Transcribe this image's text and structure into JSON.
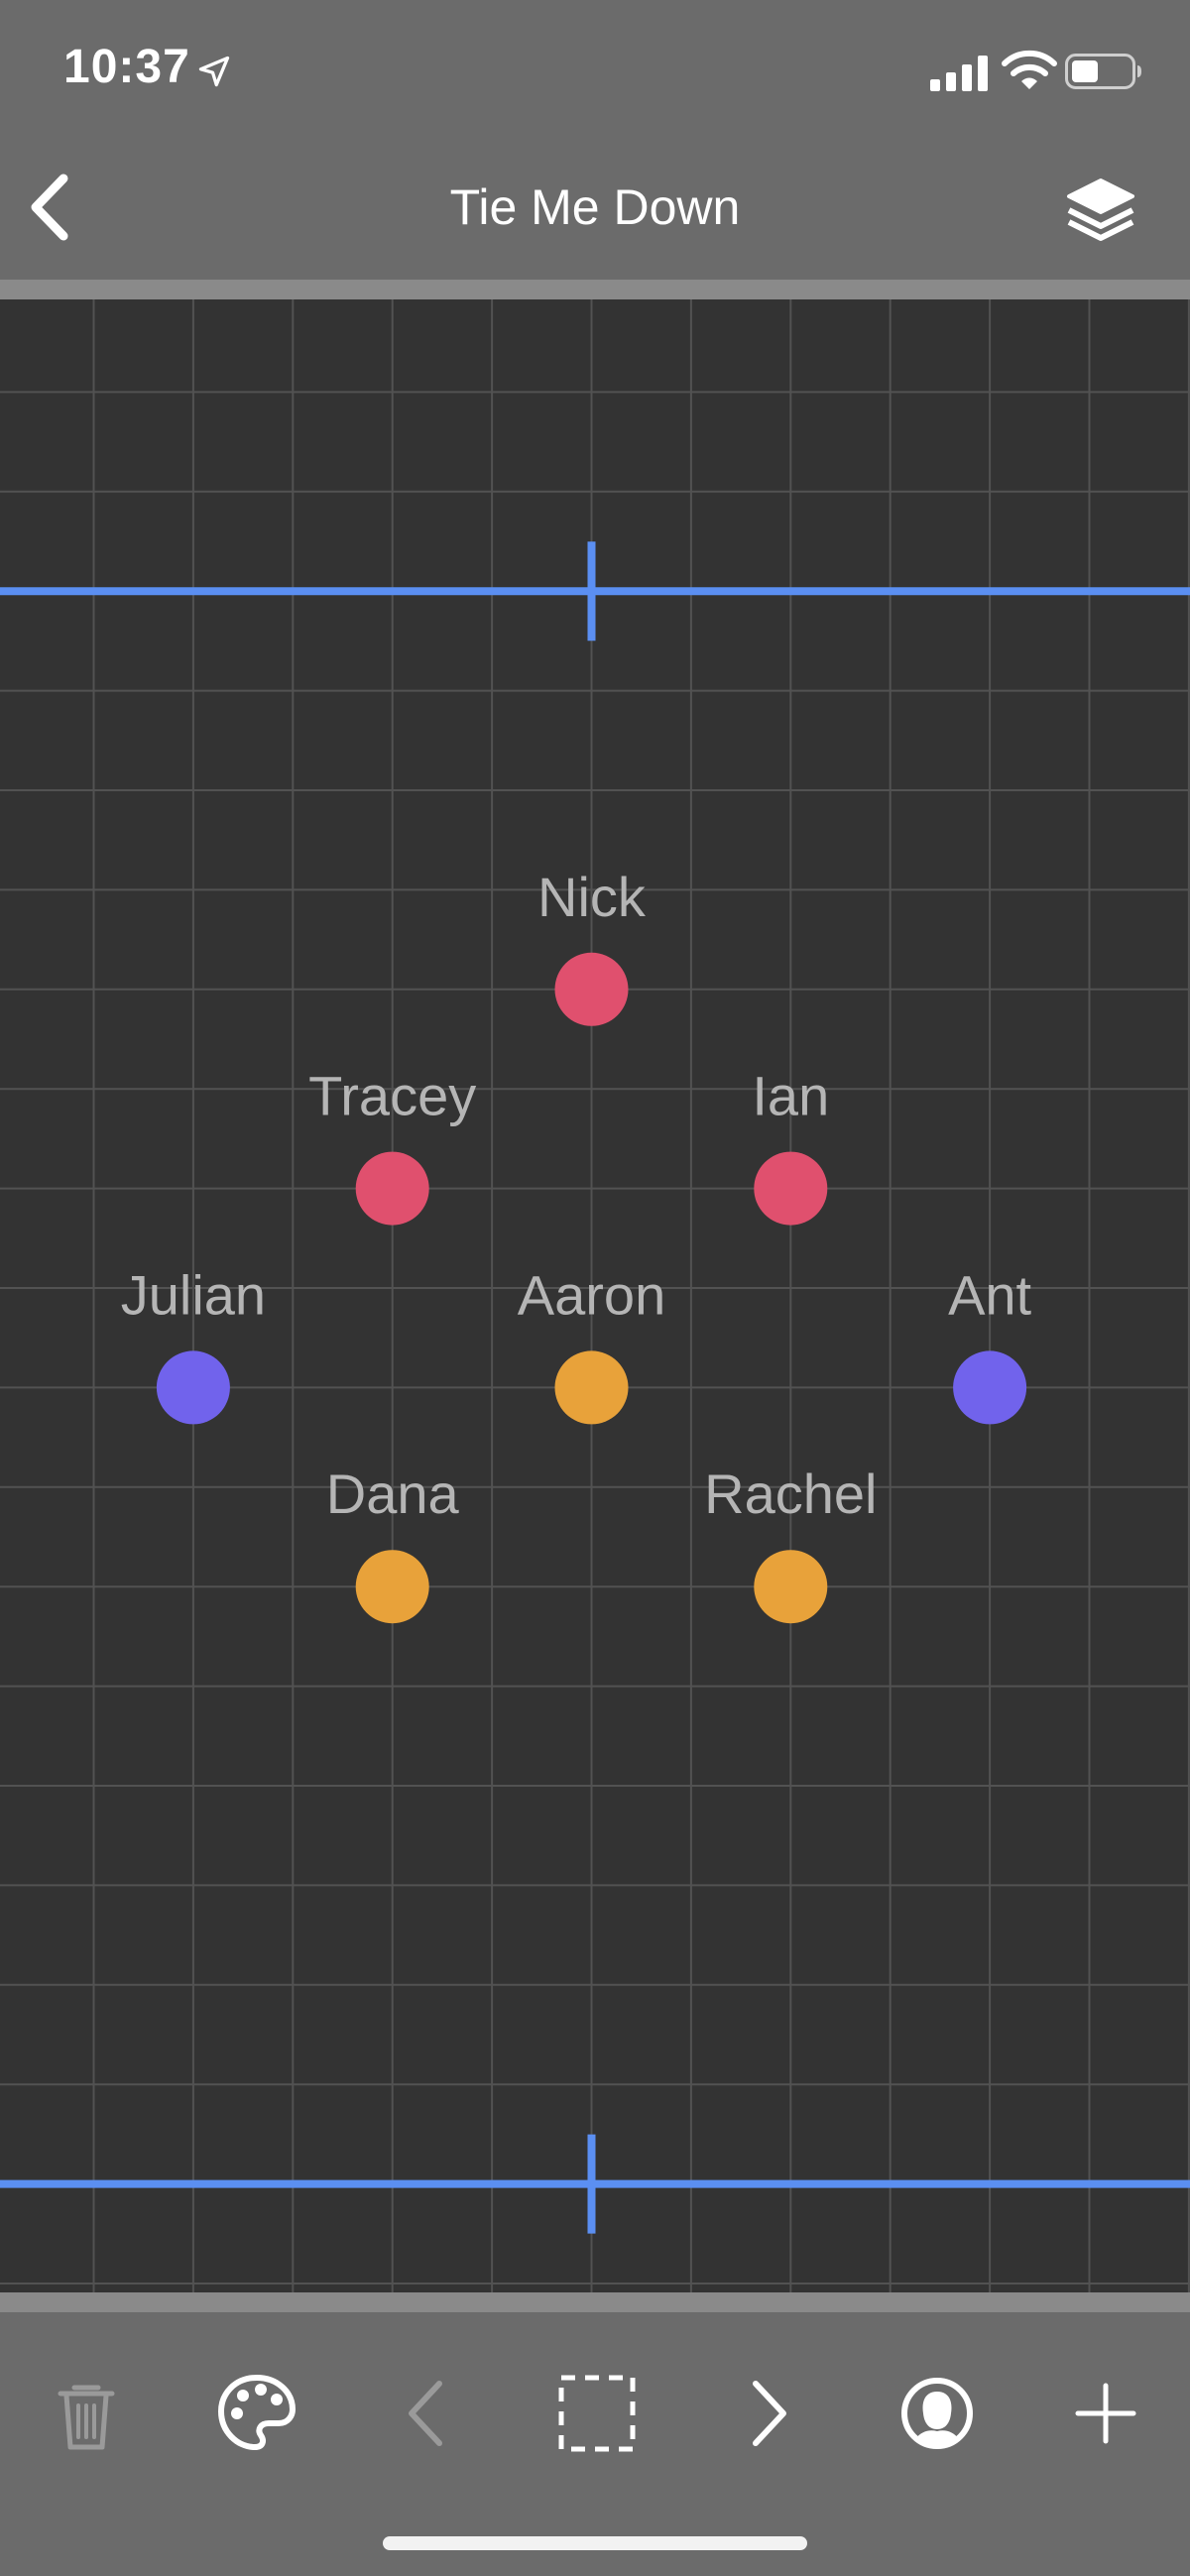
{
  "status_bar": {
    "time": "10:37",
    "icons": [
      "location-arrow-icon",
      "cellular-signal-icon",
      "wifi-icon",
      "battery-icon"
    ]
  },
  "nav": {
    "title": "Tie Me Down",
    "back_icon": "chevron-left-icon",
    "layers_icon": "layers-icon"
  },
  "colors": {
    "grid_line": "#525252",
    "canvas_bg": "#333333",
    "guide_line": "#5b8ff2",
    "red": "#e0506e",
    "orange": "#e8a23a",
    "purple": "#7163ec",
    "label": "#b5b5b5"
  },
  "stage": {
    "performers": [
      {
        "name": "Nick",
        "color": "red",
        "grid": [
          6,
          7
        ]
      },
      {
        "name": "Tracey",
        "color": "red",
        "grid": [
          4,
          9
        ]
      },
      {
        "name": "Ian",
        "color": "red",
        "grid": [
          8,
          9
        ]
      },
      {
        "name": "Julian",
        "color": "purple",
        "grid": [
          2,
          11
        ]
      },
      {
        "name": "Aaron",
        "color": "orange",
        "grid": [
          6,
          11
        ]
      },
      {
        "name": "Ant",
        "color": "purple",
        "grid": [
          10,
          11
        ]
      },
      {
        "name": "Dana",
        "color": "orange",
        "grid": [
          4,
          13
        ]
      },
      {
        "name": "Rachel",
        "color": "orange",
        "grid": [
          8,
          13
        ]
      }
    ]
  },
  "toolbar": {
    "items": [
      {
        "name": "trash-icon",
        "enabled": false
      },
      {
        "name": "palette-icon",
        "enabled": true
      },
      {
        "name": "previous-chevron-icon",
        "enabled": false
      },
      {
        "name": "selection-box-icon",
        "enabled": true
      },
      {
        "name": "next-chevron-icon",
        "enabled": true
      },
      {
        "name": "performer-face-icon",
        "enabled": true
      },
      {
        "name": "add-plus-icon",
        "enabled": true
      }
    ]
  }
}
